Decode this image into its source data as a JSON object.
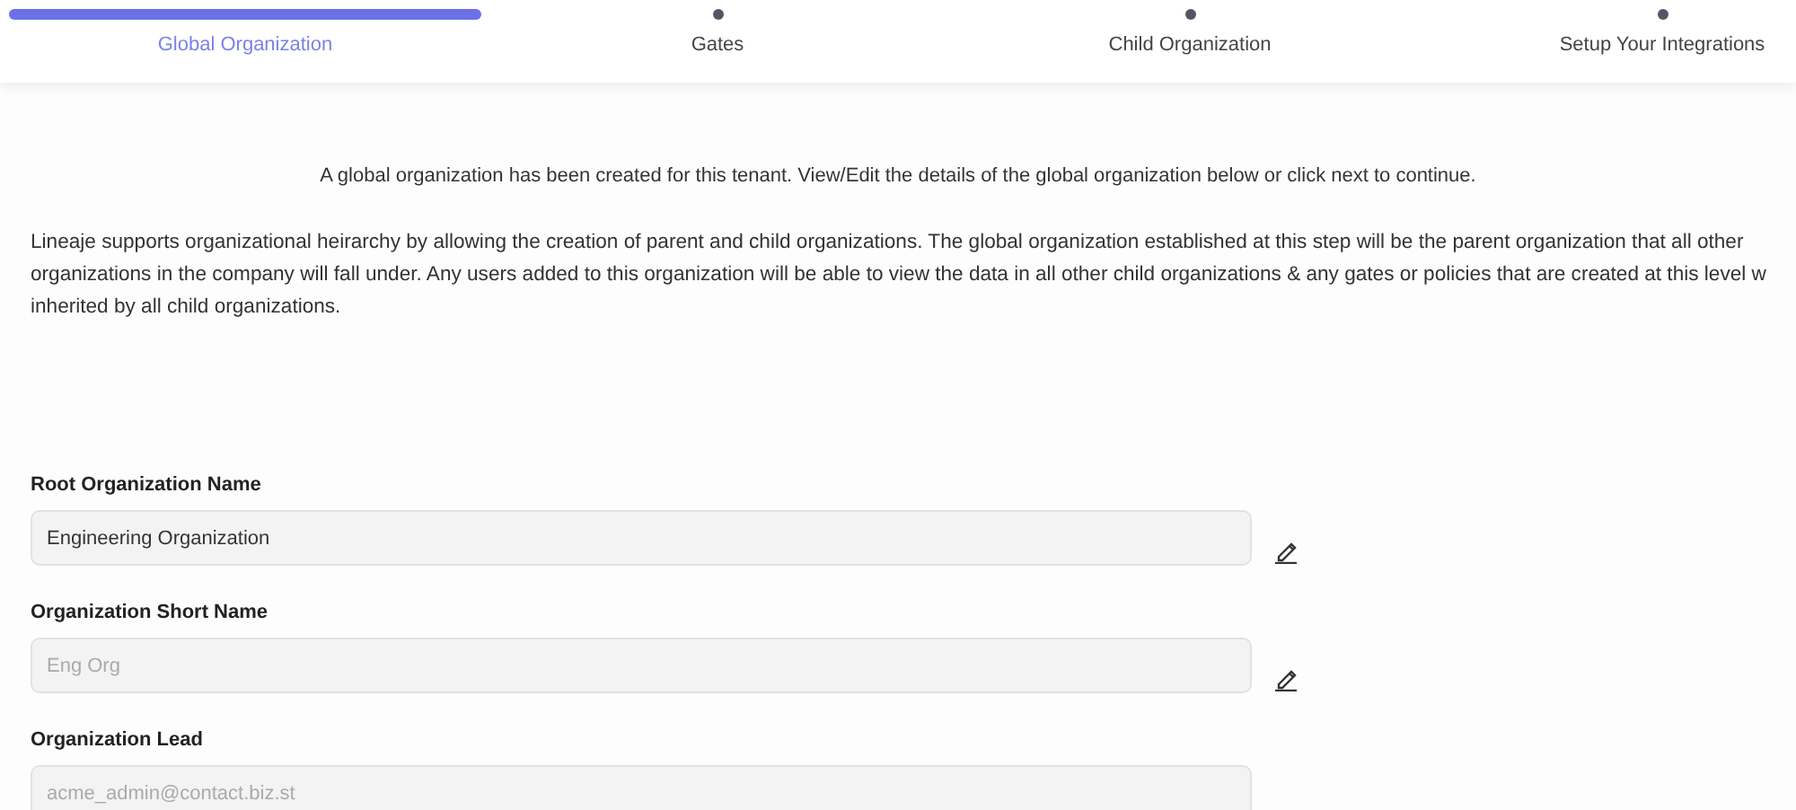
{
  "steps": [
    {
      "label": "Global Organization",
      "selected": true
    },
    {
      "label": "Gates",
      "selected": false
    },
    {
      "label": "Child Organization",
      "selected": false
    },
    {
      "label": "Setup Your Integrations",
      "selected": false
    }
  ],
  "notice": "A global organization has been created for this tenant. View/Edit the details of the global organization below or click next to continue.",
  "description_lines": [
    "Lineaje supports organizational heirarchy by allowing the creation of parent and child organizations. The global organization established at this step will be the parent organization that all other",
    "organizations in the company will fall under. Any users added to this organization will be able to view the data in all other child organizations & any gates or policies that are created at this level w",
    "inherited by all child organizations."
  ],
  "fields": [
    {
      "label": "Root Organization Name",
      "value": "Engineering Organization",
      "editable": true
    },
    {
      "label": "Organization Short Name",
      "placeholder": "Eng Org",
      "editable": true
    },
    {
      "label": "Organization Lead",
      "placeholder": "acme_admin@contact.biz.st",
      "editable": false
    }
  ]
}
